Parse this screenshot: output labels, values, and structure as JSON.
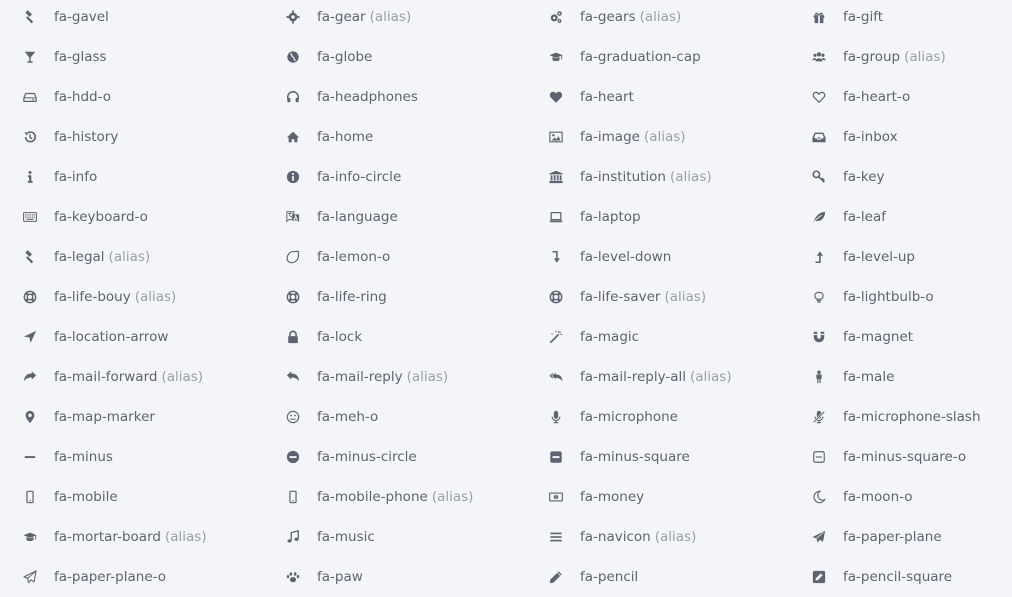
{
  "alias_label": "(alias)",
  "icons": [
    {
      "name": "fa-gavel",
      "alias": false,
      "icon": "gavel-icon"
    },
    {
      "name": "fa-gear",
      "alias": true,
      "icon": "gear-icon"
    },
    {
      "name": "fa-gears",
      "alias": true,
      "icon": "gears-icon"
    },
    {
      "name": "fa-gift",
      "alias": false,
      "icon": "gift-icon"
    },
    {
      "name": "fa-glass",
      "alias": false,
      "icon": "glass-icon"
    },
    {
      "name": "fa-globe",
      "alias": false,
      "icon": "globe-icon"
    },
    {
      "name": "fa-graduation-cap",
      "alias": false,
      "icon": "graduation-cap-icon"
    },
    {
      "name": "fa-group",
      "alias": true,
      "icon": "group-icon"
    },
    {
      "name": "fa-hdd-o",
      "alias": false,
      "icon": "hdd-icon"
    },
    {
      "name": "fa-headphones",
      "alias": false,
      "icon": "headphones-icon"
    },
    {
      "name": "fa-heart",
      "alias": false,
      "icon": "heart-icon"
    },
    {
      "name": "fa-heart-o",
      "alias": false,
      "icon": "heart-outline-icon"
    },
    {
      "name": "fa-history",
      "alias": false,
      "icon": "history-icon"
    },
    {
      "name": "fa-home",
      "alias": false,
      "icon": "home-icon"
    },
    {
      "name": "fa-image",
      "alias": true,
      "icon": "image-icon"
    },
    {
      "name": "fa-inbox",
      "alias": false,
      "icon": "inbox-icon"
    },
    {
      "name": "fa-info",
      "alias": false,
      "icon": "info-icon"
    },
    {
      "name": "fa-info-circle",
      "alias": false,
      "icon": "info-circle-icon"
    },
    {
      "name": "fa-institution",
      "alias": true,
      "icon": "institution-icon"
    },
    {
      "name": "fa-key",
      "alias": false,
      "icon": "key-icon"
    },
    {
      "name": "fa-keyboard-o",
      "alias": false,
      "icon": "keyboard-icon"
    },
    {
      "name": "fa-language",
      "alias": false,
      "icon": "language-icon"
    },
    {
      "name": "fa-laptop",
      "alias": false,
      "icon": "laptop-icon"
    },
    {
      "name": "fa-leaf",
      "alias": false,
      "icon": "leaf-icon"
    },
    {
      "name": "fa-legal",
      "alias": true,
      "icon": "gavel-icon"
    },
    {
      "name": "fa-lemon-o",
      "alias": false,
      "icon": "lemon-icon"
    },
    {
      "name": "fa-level-down",
      "alias": false,
      "icon": "level-down-icon"
    },
    {
      "name": "fa-level-up",
      "alias": false,
      "icon": "level-up-icon"
    },
    {
      "name": "fa-life-bouy",
      "alias": true,
      "icon": "life-ring-icon"
    },
    {
      "name": "fa-life-ring",
      "alias": false,
      "icon": "life-ring-icon"
    },
    {
      "name": "fa-life-saver",
      "alias": true,
      "icon": "life-ring-icon"
    },
    {
      "name": "fa-lightbulb-o",
      "alias": false,
      "icon": "lightbulb-icon"
    },
    {
      "name": "fa-location-arrow",
      "alias": false,
      "icon": "location-arrow-icon"
    },
    {
      "name": "fa-lock",
      "alias": false,
      "icon": "lock-icon"
    },
    {
      "name": "fa-magic",
      "alias": false,
      "icon": "magic-icon"
    },
    {
      "name": "fa-magnet",
      "alias": false,
      "icon": "magnet-icon"
    },
    {
      "name": "fa-mail-forward",
      "alias": true,
      "icon": "mail-forward-icon"
    },
    {
      "name": "fa-mail-reply",
      "alias": true,
      "icon": "mail-reply-icon"
    },
    {
      "name": "fa-mail-reply-all",
      "alias": true,
      "icon": "mail-reply-all-icon"
    },
    {
      "name": "fa-male",
      "alias": false,
      "icon": "male-icon"
    },
    {
      "name": "fa-map-marker",
      "alias": false,
      "icon": "map-marker-icon"
    },
    {
      "name": "fa-meh-o",
      "alias": false,
      "icon": "meh-icon"
    },
    {
      "name": "fa-microphone",
      "alias": false,
      "icon": "microphone-icon"
    },
    {
      "name": "fa-microphone-slash",
      "alias": false,
      "icon": "microphone-slash-icon"
    },
    {
      "name": "fa-minus",
      "alias": false,
      "icon": "minus-icon"
    },
    {
      "name": "fa-minus-circle",
      "alias": false,
      "icon": "minus-circle-icon"
    },
    {
      "name": "fa-minus-square",
      "alias": false,
      "icon": "minus-square-icon"
    },
    {
      "name": "fa-minus-square-o",
      "alias": false,
      "icon": "minus-square-outline-icon"
    },
    {
      "name": "fa-mobile",
      "alias": false,
      "icon": "mobile-icon"
    },
    {
      "name": "fa-mobile-phone",
      "alias": true,
      "icon": "mobile-icon"
    },
    {
      "name": "fa-money",
      "alias": false,
      "icon": "money-icon"
    },
    {
      "name": "fa-moon-o",
      "alias": false,
      "icon": "moon-icon"
    },
    {
      "name": "fa-mortar-board",
      "alias": true,
      "icon": "graduation-cap-icon"
    },
    {
      "name": "fa-music",
      "alias": false,
      "icon": "music-icon"
    },
    {
      "name": "fa-navicon",
      "alias": true,
      "icon": "navicon-icon"
    },
    {
      "name": "fa-paper-plane",
      "alias": false,
      "icon": "paper-plane-icon"
    },
    {
      "name": "fa-paper-plane-o",
      "alias": false,
      "icon": "paper-plane-outline-icon"
    },
    {
      "name": "fa-paw",
      "alias": false,
      "icon": "paw-icon"
    },
    {
      "name": "fa-pencil",
      "alias": false,
      "icon": "pencil-icon"
    },
    {
      "name": "fa-pencil-square",
      "alias": false,
      "icon": "pencil-square-icon"
    }
  ]
}
